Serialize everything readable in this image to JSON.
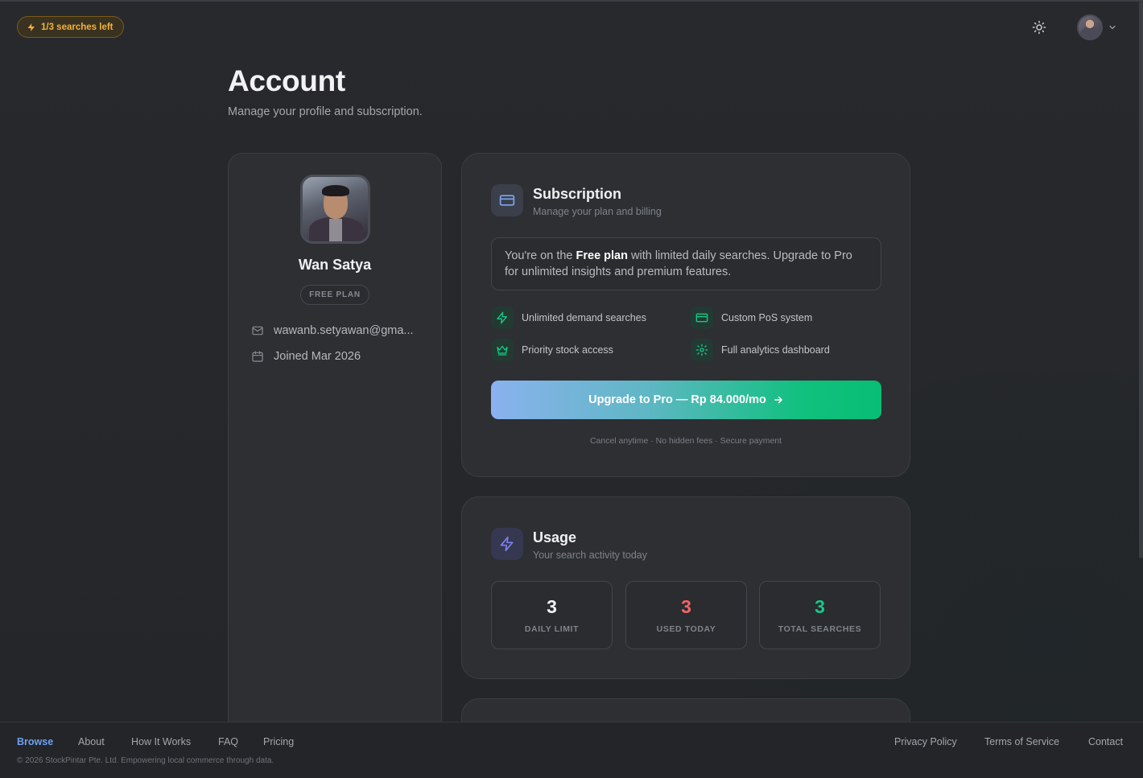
{
  "header": {
    "searches_left": "1/3 searches left"
  },
  "page": {
    "title": "Account",
    "subtitle": "Manage your profile and subscription."
  },
  "profile": {
    "name": "Wan Satya",
    "plan_badge": "FREE PLAN",
    "email": "wawanb.setyawan@gma...",
    "joined": "Joined Mar 2026"
  },
  "subscription": {
    "title": "Subscription",
    "subtitle": "Manage your plan and billing",
    "note_prefix": "You're on the ",
    "note_plan": "Free plan",
    "note_suffix": " with limited daily searches. Upgrade to Pro for unlimited insights and premium features.",
    "features": [
      {
        "label": "Unlimited demand searches",
        "icon": "zap-icon"
      },
      {
        "label": "Custom PoS system",
        "icon": "credit-card-icon"
      },
      {
        "label": "Priority stock access",
        "icon": "crown-icon"
      },
      {
        "label": "Full analytics dashboard",
        "icon": "gear-icon"
      }
    ],
    "upgrade_label": "Upgrade to Pro — Rp 84.000/mo",
    "fine_print": "Cancel anytime · No hidden fees · Secure payment"
  },
  "usage": {
    "title": "Usage",
    "subtitle": "Your search activity today",
    "stats": [
      {
        "value": "3",
        "label": "DAILY LIMIT",
        "color": "#f0f0f2"
      },
      {
        "value": "3",
        "label": "USED TODAY",
        "color": "#f26463"
      },
      {
        "value": "3",
        "label": "TOTAL SEARCHES",
        "color": "#14c98a"
      }
    ]
  },
  "footer": {
    "links_left": [
      "Browse",
      "About",
      "How It Works",
      "FAQ",
      "Pricing"
    ],
    "links_right": [
      "Privacy Policy",
      "Terms of Service",
      "Contact"
    ],
    "copyright": "© 2026 StockPintar Pte. Ltd. Empowering local commerce through data."
  },
  "colors": {
    "accent_green": "#10c07e",
    "accent_blue": "#6ea0f2",
    "warning": "#f3b23a"
  }
}
